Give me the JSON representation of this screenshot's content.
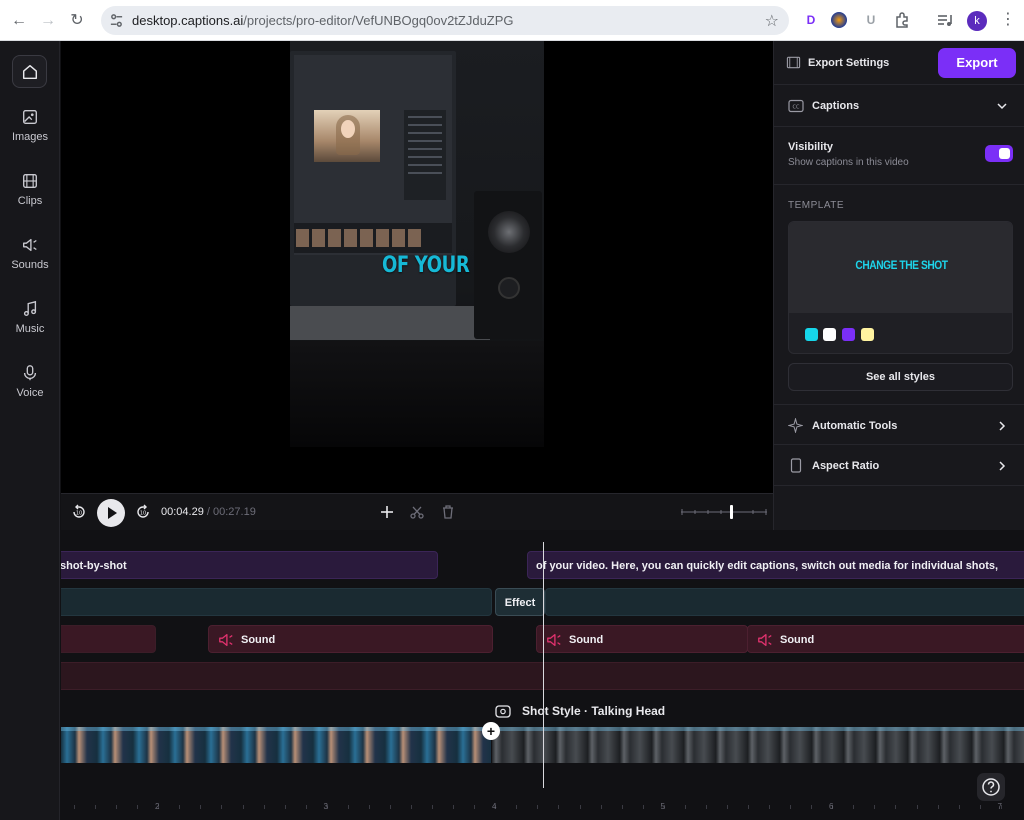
{
  "browser": {
    "url_host": "desktop.captions.ai",
    "url_path": "/projects/pro-editor/VefUNBOgq0ov2tZJduZPG",
    "profile_initial": "k"
  },
  "sidebar": {
    "items": [
      {
        "label": "Images",
        "icon": "image-icon"
      },
      {
        "label": "Clips",
        "icon": "film-icon"
      },
      {
        "label": "Sounds",
        "icon": "speaker-icon"
      },
      {
        "label": "Music",
        "icon": "music-note-icon"
      },
      {
        "label": "Voice",
        "icon": "microphone-icon"
      }
    ]
  },
  "player": {
    "caption_overlay": "OF YOUR",
    "current_time": "00:04.29",
    "separator": "/",
    "total_time": "00:27.19",
    "skip_back_label": "10",
    "skip_forward_label": "10"
  },
  "right_panel": {
    "export_settings": "Export Settings",
    "export_button": "Export",
    "captions_title": "Captions",
    "visibility_title": "Visibility",
    "visibility_desc": "Show captions in this video",
    "visibility_on": true,
    "template_heading": "TEMPLATE",
    "template_preview_text": "CHANGE THE SHOT",
    "template_colors": [
      "#16d6ea",
      "#ffffff",
      "#7b2ff7",
      "#fff3a0"
    ],
    "see_all_styles": "See all styles",
    "automatic_tools": "Automatic Tools",
    "aspect_ratio": "Aspect Ratio"
  },
  "timeline": {
    "caption_clip_1": "shot-by-shot",
    "caption_clip_2": "of your video. Here, you can quickly edit captions, switch out media for individual shots,",
    "effect_label": "Effect",
    "sound_label_1": "Sound",
    "sound_label_2": "Sound",
    "sound_label_3": "Sound",
    "shot_style_label": "Shot Style · Talking Head",
    "ruler_marks": [
      "2",
      "3",
      "4",
      "5",
      "6",
      "7"
    ]
  },
  "colors": {
    "accent": "#7b2ff7",
    "caption_cyan": "#16b9d6"
  }
}
